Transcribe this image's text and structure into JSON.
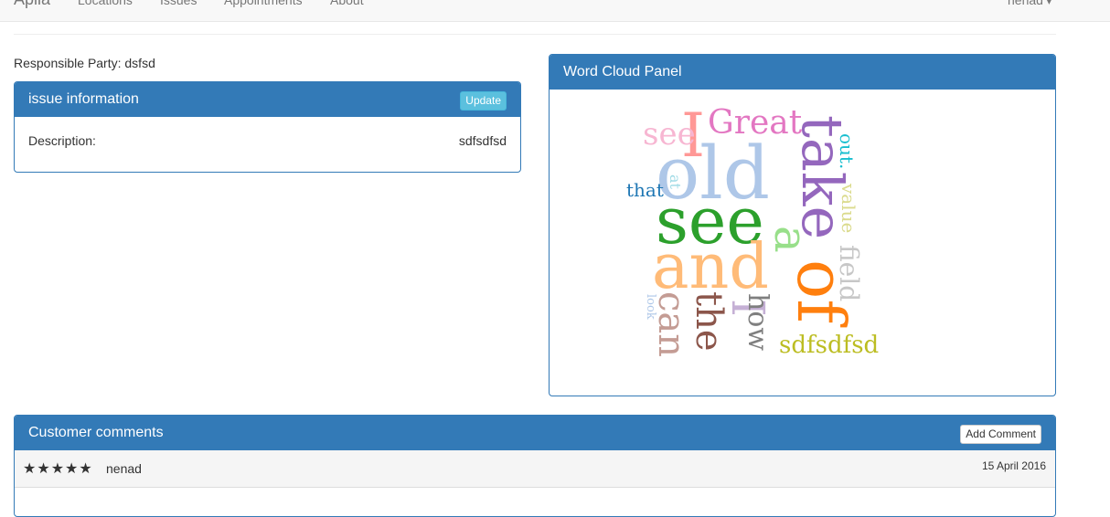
{
  "navbar": {
    "brand": "Aplia",
    "links": [
      "Locations",
      "Issues",
      "Appointments",
      "About"
    ],
    "user": "nenad",
    "user_caret": "▾"
  },
  "responsible_party": "Responsible Party: dsfsd",
  "issue_panel": {
    "title": "issue information",
    "update_label": "Update",
    "description_label": "Description:",
    "description_value": "sdfsdfsd"
  },
  "word_cloud": {
    "title": "Word Cloud Panel",
    "words": [
      {
        "text": "I",
        "color": "#ff9896"
      },
      {
        "text": "Great",
        "color": "#e377c2"
      },
      {
        "text": "see",
        "color": "#f7b6d2"
      },
      {
        "text": "old",
        "color": "#aec7e8"
      },
      {
        "text": "take",
        "color": "#9467bd"
      },
      {
        "text": "out.",
        "color": "#17becf"
      },
      {
        "text": "that",
        "color": "#1f77b4"
      },
      {
        "text": "at",
        "color": "#9edae5"
      },
      {
        "text": "see",
        "color": "#2ca02c"
      },
      {
        "text": "value",
        "color": "#dbdb8d"
      },
      {
        "text": "a",
        "color": "#98df8a"
      },
      {
        "text": "and",
        "color": "#ffbb78"
      },
      {
        "text": "field",
        "color": "#c7c7c7"
      },
      {
        "text": "of",
        "color": "#ff7f0e"
      },
      {
        "text": "I",
        "color": "#c5b0d5"
      },
      {
        "text": "look",
        "color": "#aec7e8"
      },
      {
        "text": "can",
        "color": "#c49c94"
      },
      {
        "text": "the",
        "color": "#8c564b"
      },
      {
        "text": "how",
        "color": "#7f7f7f"
      },
      {
        "text": "sdfsdfsd",
        "color": "#bcbd22"
      }
    ]
  },
  "comments_panel": {
    "title": "Customer comments",
    "add_label": "Add Comment",
    "comments": [
      {
        "stars": "★★★★★",
        "user": "nenad",
        "date": "15 April 2016"
      }
    ]
  }
}
